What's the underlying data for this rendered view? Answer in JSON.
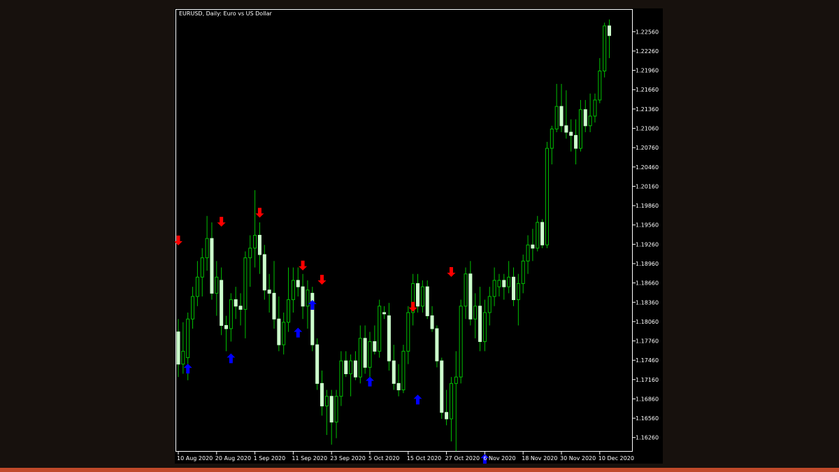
{
  "chart_data": {
    "type": "candlestick",
    "title": "EURUSD, Daily:  Euro vs US Dollar",
    "ylim": [
      1.1604,
      1.229
    ],
    "y_ticks": [
      "1.22560",
      "1.22260",
      "1.21960",
      "1.21660",
      "1.21360",
      "1.21060",
      "1.20760",
      "1.20460",
      "1.20160",
      "1.19860",
      "1.19560",
      "1.19260",
      "1.18960",
      "1.18660",
      "1.18360",
      "1.18060",
      "1.17760",
      "1.17460",
      "1.17160",
      "1.16860",
      "1.16560",
      "1.16260"
    ],
    "x_labels": [
      "10 Aug 2020",
      "20 Aug 2020",
      "1 Sep 2020",
      "11 Sep 2020",
      "23 Sep 2020",
      "5 Oct 2020",
      "15 Oct 2020",
      "27 Oct 2020",
      "6 Nov 2020",
      "18 Nov 2020",
      "30 Nov 2020",
      "10 Dec 2020"
    ],
    "x_label_candle_index": [
      0,
      8,
      16,
      24,
      32,
      40,
      48,
      56,
      64,
      72,
      80,
      88
    ],
    "colors": {
      "background": "#000000",
      "frame": "#ffffff",
      "bull_body": "#000000",
      "bull_outline": "#00c000",
      "bear_body": "#ccffcc",
      "wick": "#00c000",
      "buy_arrow": "#0000ff",
      "sell_arrow": "#ff0000",
      "text": "#ffffff"
    },
    "candles": [
      {
        "o": 1.179,
        "h": 1.181,
        "l": 1.172,
        "c": 1.174
      },
      {
        "o": 1.174,
        "h": 1.1805,
        "l": 1.1725,
        "c": 1.176
      },
      {
        "o": 1.175,
        "h": 1.182,
        "l": 1.1715,
        "c": 1.181
      },
      {
        "o": 1.181,
        "h": 1.186,
        "l": 1.1795,
        "c": 1.1845
      },
      {
        "o": 1.1845,
        "h": 1.19,
        "l": 1.183,
        "c": 1.1875
      },
      {
        "o": 1.1875,
        "h": 1.192,
        "l": 1.1845,
        "c": 1.1905
      },
      {
        "o": 1.1905,
        "h": 1.197,
        "l": 1.1885,
        "c": 1.1935
      },
      {
        "o": 1.1935,
        "h": 1.196,
        "l": 1.184,
        "c": 1.185
      },
      {
        "o": 1.185,
        "h": 1.19,
        "l": 1.1815,
        "c": 1.1875
      },
      {
        "o": 1.187,
        "h": 1.189,
        "l": 1.1785,
        "c": 1.18
      },
      {
        "o": 1.18,
        "h": 1.1815,
        "l": 1.176,
        "c": 1.1795
      },
      {
        "o": 1.1795,
        "h": 1.185,
        "l": 1.1775,
        "c": 1.184
      },
      {
        "o": 1.184,
        "h": 1.186,
        "l": 1.181,
        "c": 1.183
      },
      {
        "o": 1.183,
        "h": 1.185,
        "l": 1.18,
        "c": 1.1825
      },
      {
        "o": 1.1825,
        "h": 1.1915,
        "l": 1.178,
        "c": 1.1905
      },
      {
        "o": 1.1905,
        "h": 1.194,
        "l": 1.186,
        "c": 1.192
      },
      {
        "o": 1.192,
        "h": 1.201,
        "l": 1.189,
        "c": 1.194
      },
      {
        "o": 1.194,
        "h": 1.196,
        "l": 1.188,
        "c": 1.191
      },
      {
        "o": 1.191,
        "h": 1.1925,
        "l": 1.184,
        "c": 1.1855
      },
      {
        "o": 1.1855,
        "h": 1.188,
        "l": 1.182,
        "c": 1.185
      },
      {
        "o": 1.185,
        "h": 1.19,
        "l": 1.1795,
        "c": 1.181
      },
      {
        "o": 1.181,
        "h": 1.1845,
        "l": 1.176,
        "c": 1.177
      },
      {
        "o": 1.177,
        "h": 1.182,
        "l": 1.1755,
        "c": 1.1805
      },
      {
        "o": 1.1805,
        "h": 1.189,
        "l": 1.179,
        "c": 1.184
      },
      {
        "o": 1.184,
        "h": 1.189,
        "l": 1.182,
        "c": 1.187
      },
      {
        "o": 1.187,
        "h": 1.189,
        "l": 1.1845,
        "c": 1.186
      },
      {
        "o": 1.186,
        "h": 1.188,
        "l": 1.181,
        "c": 1.183
      },
      {
        "o": 1.183,
        "h": 1.187,
        "l": 1.1795,
        "c": 1.1855
      },
      {
        "o": 1.185,
        "h": 1.186,
        "l": 1.176,
        "c": 1.177
      },
      {
        "o": 1.177,
        "h": 1.178,
        "l": 1.17,
        "c": 1.171
      },
      {
        "o": 1.171,
        "h": 1.173,
        "l": 1.166,
        "c": 1.1675
      },
      {
        "o": 1.1675,
        "h": 1.17,
        "l": 1.163,
        "c": 1.169
      },
      {
        "o": 1.169,
        "h": 1.17,
        "l": 1.1615,
        "c": 1.165
      },
      {
        "o": 1.165,
        "h": 1.17,
        "l": 1.1625,
        "c": 1.169
      },
      {
        "o": 1.169,
        "h": 1.176,
        "l": 1.1675,
        "c": 1.1745
      },
      {
        "o": 1.1745,
        "h": 1.176,
        "l": 1.172,
        "c": 1.1725
      },
      {
        "o": 1.1725,
        "h": 1.1755,
        "l": 1.169,
        "c": 1.1745
      },
      {
        "o": 1.1745,
        "h": 1.176,
        "l": 1.1715,
        "c": 1.172
      },
      {
        "o": 1.172,
        "h": 1.18,
        "l": 1.171,
        "c": 1.178
      },
      {
        "o": 1.178,
        "h": 1.18,
        "l": 1.1725,
        "c": 1.1735
      },
      {
        "o": 1.1735,
        "h": 1.179,
        "l": 1.172,
        "c": 1.1775
      },
      {
        "o": 1.1775,
        "h": 1.18,
        "l": 1.1755,
        "c": 1.176
      },
      {
        "o": 1.176,
        "h": 1.184,
        "l": 1.175,
        "c": 1.183
      },
      {
        "o": 1.182,
        "h": 1.183,
        "l": 1.181,
        "c": 1.1818
      },
      {
        "o": 1.1815,
        "h": 1.1835,
        "l": 1.173,
        "c": 1.1745
      },
      {
        "o": 1.1745,
        "h": 1.177,
        "l": 1.17,
        "c": 1.171
      },
      {
        "o": 1.171,
        "h": 1.174,
        "l": 1.169,
        "c": 1.17
      },
      {
        "o": 1.17,
        "h": 1.177,
        "l": 1.1695,
        "c": 1.176
      },
      {
        "o": 1.176,
        "h": 1.183,
        "l": 1.174,
        "c": 1.182
      },
      {
        "o": 1.182,
        "h": 1.188,
        "l": 1.18,
        "c": 1.1865
      },
      {
        "o": 1.1865,
        "h": 1.188,
        "l": 1.182,
        "c": 1.183
      },
      {
        "o": 1.183,
        "h": 1.187,
        "l": 1.182,
        "c": 1.186
      },
      {
        "o": 1.186,
        "h": 1.187,
        "l": 1.181,
        "c": 1.1815
      },
      {
        "o": 1.1815,
        "h": 1.183,
        "l": 1.179,
        "c": 1.1795
      },
      {
        "o": 1.1795,
        "h": 1.18,
        "l": 1.1735,
        "c": 1.1745
      },
      {
        "o": 1.1745,
        "h": 1.175,
        "l": 1.1655,
        "c": 1.1665
      },
      {
        "o": 1.1665,
        "h": 1.17,
        "l": 1.1645,
        "c": 1.1655
      },
      {
        "o": 1.1655,
        "h": 1.172,
        "l": 1.162,
        "c": 1.171
      },
      {
        "o": 1.171,
        "h": 1.176,
        "l": 1.1605,
        "c": 1.172
      },
      {
        "o": 1.172,
        "h": 1.184,
        "l": 1.171,
        "c": 1.183
      },
      {
        "o": 1.183,
        "h": 1.189,
        "l": 1.181,
        "c": 1.188
      },
      {
        "o": 1.188,
        "h": 1.19,
        "l": 1.18,
        "c": 1.181
      },
      {
        "o": 1.181,
        "h": 1.185,
        "l": 1.178,
        "c": 1.183
      },
      {
        "o": 1.183,
        "h": 1.186,
        "l": 1.176,
        "c": 1.1775
      },
      {
        "o": 1.1775,
        "h": 1.184,
        "l": 1.176,
        "c": 1.182
      },
      {
        "o": 1.182,
        "h": 1.186,
        "l": 1.18,
        "c": 1.1845
      },
      {
        "o": 1.1845,
        "h": 1.189,
        "l": 1.183,
        "c": 1.187
      },
      {
        "o": 1.186,
        "h": 1.188,
        "l": 1.1845,
        "c": 1.187
      },
      {
        "o": 1.187,
        "h": 1.188,
        "l": 1.184,
        "c": 1.186
      },
      {
        "o": 1.186,
        "h": 1.19,
        "l": 1.185,
        "c": 1.1875
      },
      {
        "o": 1.1875,
        "h": 1.189,
        "l": 1.183,
        "c": 1.184
      },
      {
        "o": 1.184,
        "h": 1.188,
        "l": 1.18,
        "c": 1.1865
      },
      {
        "o": 1.1865,
        "h": 1.191,
        "l": 1.185,
        "c": 1.19
      },
      {
        "o": 1.19,
        "h": 1.194,
        "l": 1.188,
        "c": 1.1925
      },
      {
        "o": 1.1925,
        "h": 1.195,
        "l": 1.19,
        "c": 1.192
      },
      {
        "o": 1.192,
        "h": 1.197,
        "l": 1.1915,
        "c": 1.196
      },
      {
        "o": 1.196,
        "h": 1.1965,
        "l": 1.192,
        "c": 1.1925
      },
      {
        "o": 1.1925,
        "h": 1.2085,
        "l": 1.192,
        "c": 1.2075
      },
      {
        "o": 1.2075,
        "h": 1.211,
        "l": 1.205,
        "c": 1.2105
      },
      {
        "o": 1.2105,
        "h": 1.2175,
        "l": 1.21,
        "c": 1.214
      },
      {
        "o": 1.214,
        "h": 1.2175,
        "l": 1.21,
        "c": 1.211
      },
      {
        "o": 1.211,
        "h": 1.2165,
        "l": 1.209,
        "c": 1.21
      },
      {
        "o": 1.21,
        "h": 1.212,
        "l": 1.207,
        "c": 1.2095
      },
      {
        "o": 1.2095,
        "h": 1.212,
        "l": 1.205,
        "c": 1.2075
      },
      {
        "o": 1.2075,
        "h": 1.215,
        "l": 1.207,
        "c": 1.2135
      },
      {
        "o": 1.2135,
        "h": 1.215,
        "l": 1.21,
        "c": 1.211
      },
      {
        "o": 1.211,
        "h": 1.216,
        "l": 1.21,
        "c": 1.2125
      },
      {
        "o": 1.2125,
        "h": 1.216,
        "l": 1.2115,
        "c": 1.215
      },
      {
        "o": 1.215,
        "h": 1.2215,
        "l": 1.2145,
        "c": 1.2195
      },
      {
        "o": 1.2195,
        "h": 1.227,
        "l": 1.2185,
        "c": 1.2265
      },
      {
        "o": 1.2265,
        "h": 1.2275,
        "l": 1.2215,
        "c": 1.225
      }
    ],
    "arrows": [
      {
        "i": 0,
        "dir": "sell",
        "price": 1.1932
      },
      {
        "i": 2,
        "dir": "buy",
        "price": 1.1733
      },
      {
        "i": 9,
        "dir": "sell",
        "price": 1.1961
      },
      {
        "i": 11,
        "dir": "buy",
        "price": 1.1749
      },
      {
        "i": 17,
        "dir": "sell",
        "price": 1.1975
      },
      {
        "i": 25,
        "dir": "buy",
        "price": 1.1789
      },
      {
        "i": 26,
        "dir": "sell",
        "price": 1.1893
      },
      {
        "i": 28,
        "dir": "buy",
        "price": 1.1832
      },
      {
        "i": 30,
        "dir": "sell",
        "price": 1.1871
      },
      {
        "i": 40,
        "dir": "buy",
        "price": 1.1713
      },
      {
        "i": 49,
        "dir": "sell",
        "price": 1.1829
      },
      {
        "i": 50,
        "dir": "buy",
        "price": 1.1685
      },
      {
        "i": 57,
        "dir": "sell",
        "price": 1.1883
      },
      {
        "i": 64,
        "dir": "buy",
        "price": 1.1593
      }
    ]
  }
}
